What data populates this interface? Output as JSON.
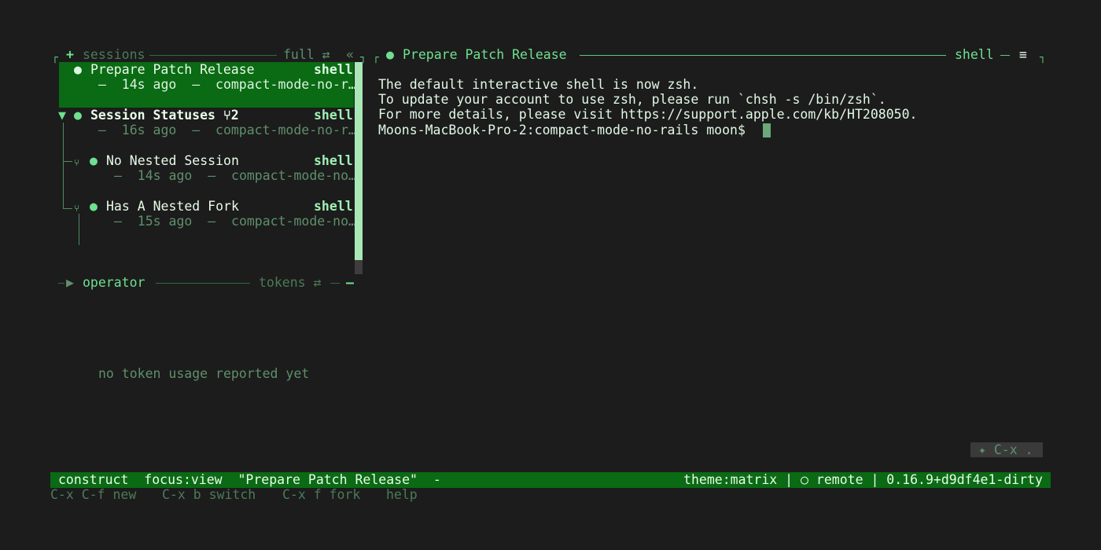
{
  "sessions_panel": {
    "plus": "+",
    "title": "sessions",
    "mode": "full ⇄",
    "collapse": "«",
    "items": [
      {
        "dot": "●",
        "title": "Prepare Patch Release",
        "kind": "shell",
        "meta": "—  14s ago  —  compact-mode-no-r…"
      },
      {
        "expander": "▼",
        "dot": "●",
        "title": "Session Statuses ⑂2",
        "kind": "shell",
        "meta": "—  16s ago  —  compact-mode-no-r…"
      },
      {
        "fork": "⑂",
        "dot": "●",
        "title": "No Nested Session",
        "kind": "shell",
        "meta": "—  14s ago  —  compact-mode-no…"
      },
      {
        "fork": "⑂",
        "dot": "●",
        "title": "Has A Nested Fork",
        "kind": "shell",
        "meta": "—  15s ago  —  compact-mode-no…"
      }
    ]
  },
  "operator_panel": {
    "arrow": "▶",
    "title": "operator",
    "tokens": "tokens ⇄",
    "dash": "–",
    "empty_text": "no token usage reported yet"
  },
  "terminal": {
    "dot": "●",
    "title": "Prepare Patch Release",
    "kind": "shell",
    "menu": "≡",
    "lines": [
      "The default interactive shell is now zsh.",
      "To update your account to use zsh, please run `chsh -s /bin/zsh`.",
      "For more details, please visit https://support.apple.com/kb/HT208050.",
      "Moons-MacBook-Pro-2:compact-mode-no-rails moon$ "
    ]
  },
  "hint": "✦ C-x .",
  "statusbar": {
    "left": "construct  focus:view  \"Prepare Patch Release\"  -",
    "right": "theme:matrix | ○ remote | 0.16.9+d9df4e1-dirty"
  },
  "shortcuts": [
    {
      "label": "C-x C-f new"
    },
    {
      "label": "C-x b switch"
    },
    {
      "label": "C-x f fork"
    },
    {
      "label": "help"
    }
  ]
}
